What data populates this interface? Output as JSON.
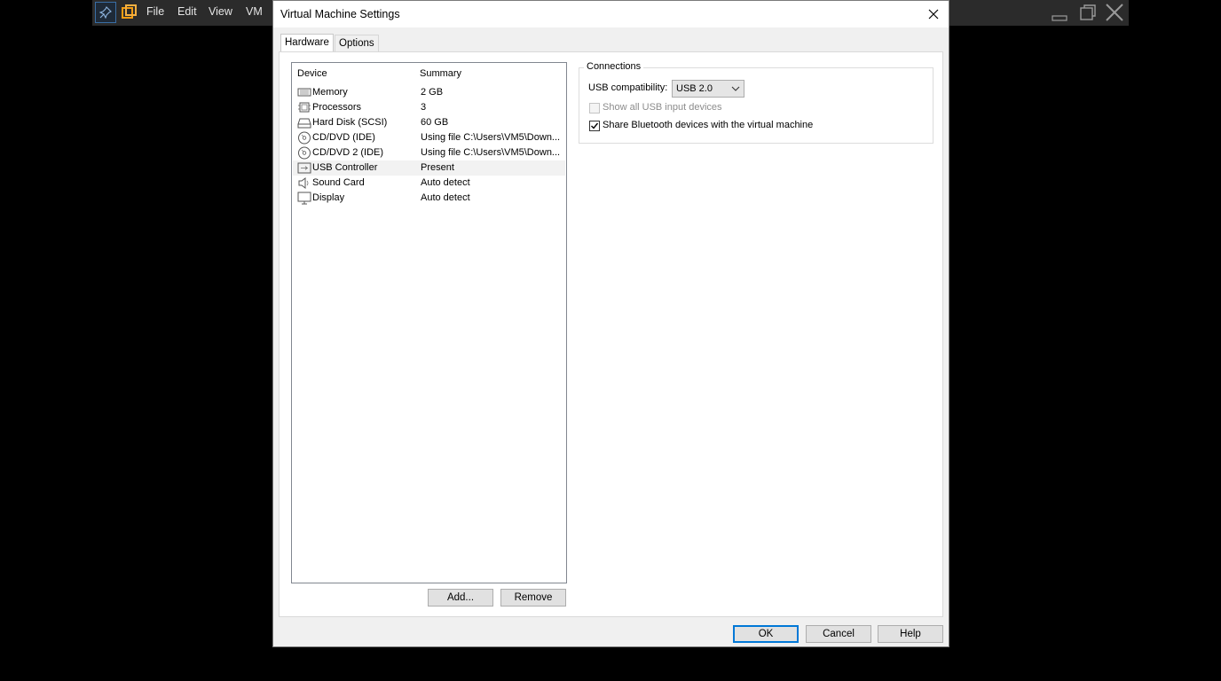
{
  "host": {
    "menu": [
      "File",
      "Edit",
      "View",
      "VM"
    ]
  },
  "dialog": {
    "title": "Virtual Machine Settings",
    "tabs": [
      {
        "label": "Hardware",
        "active": true
      },
      {
        "label": "Options",
        "active": false
      }
    ],
    "device_list": {
      "headers": {
        "device": "Device",
        "summary": "Summary"
      },
      "rows": [
        {
          "device": "Memory",
          "summary": "2 GB",
          "icon": "memory-icon"
        },
        {
          "device": "Processors",
          "summary": "3",
          "icon": "processor-icon"
        },
        {
          "device": "Hard Disk (SCSI)",
          "summary": "60 GB",
          "icon": "hard-disk-icon"
        },
        {
          "device": "CD/DVD (IDE)",
          "summary": "Using file C:\\Users\\VM5\\Down...",
          "icon": "cd-dvd-icon"
        },
        {
          "device": "CD/DVD 2 (IDE)",
          "summary": "Using file C:\\Users\\VM5\\Down...",
          "icon": "cd-dvd-icon"
        },
        {
          "device": "USB Controller",
          "summary": "Present",
          "icon": "usb-icon",
          "selected": true
        },
        {
          "device": "Sound Card",
          "summary": "Auto detect",
          "icon": "speaker-icon"
        },
        {
          "device": "Display",
          "summary": "Auto detect",
          "icon": "monitor-icon"
        }
      ]
    },
    "add_label": "Add...",
    "remove_label": "Remove",
    "connections": {
      "legend": "Connections",
      "usb_compat_label": "USB compatibility:",
      "usb_compat_value": "USB 2.0",
      "show_all_label": "Show all USB input devices",
      "show_all_checked": false,
      "show_all_enabled": false,
      "share_bt_label": "Share Bluetooth devices with the virtual machine",
      "share_bt_checked": true
    },
    "footer": {
      "ok_label": "OK",
      "cancel_label": "Cancel",
      "help_label": "Help"
    }
  }
}
